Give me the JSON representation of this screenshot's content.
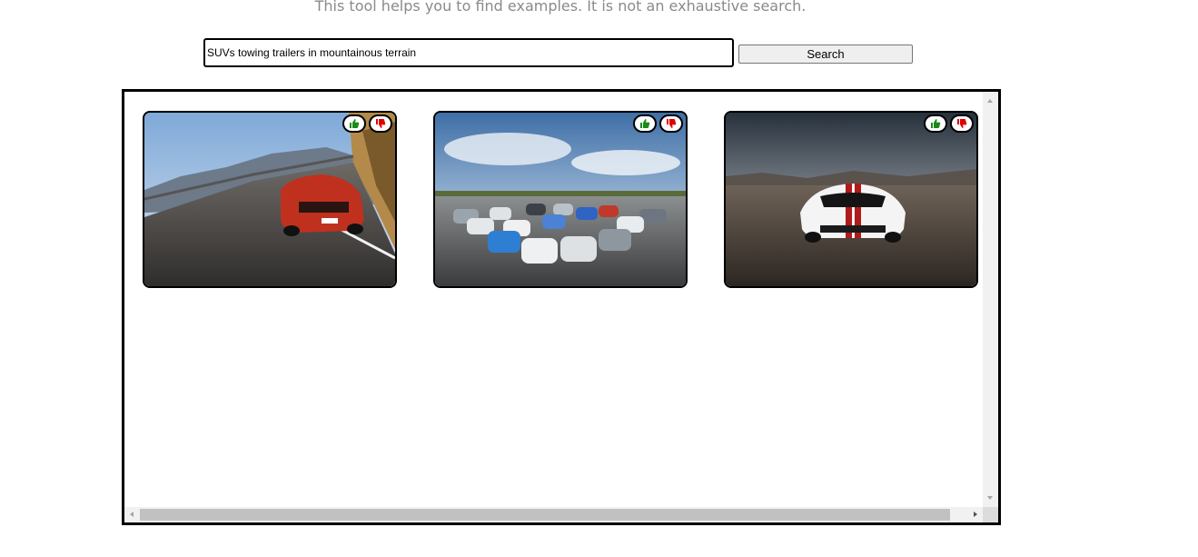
{
  "header": {
    "subtitle": "This tool helps you to find examples. It is not an exhaustive search."
  },
  "search": {
    "value": "SUVs towing trailers in mountainous terrain",
    "button_label": "Search"
  },
  "results": {
    "cards": [
      {
        "image": "red-sports-car-mountain-road-photo"
      },
      {
        "image": "electric-cars-group-runway-photo"
      },
      {
        "image": "white-sports-car-desert-photo"
      }
    ],
    "vote_icons": {
      "up": "thumbs-up-icon",
      "down": "thumbs-down-icon"
    }
  },
  "colors": {
    "thumb_up": "#1a8a1a",
    "thumb_down": "#e00000",
    "subtitle_text": "#8a8a8a"
  }
}
